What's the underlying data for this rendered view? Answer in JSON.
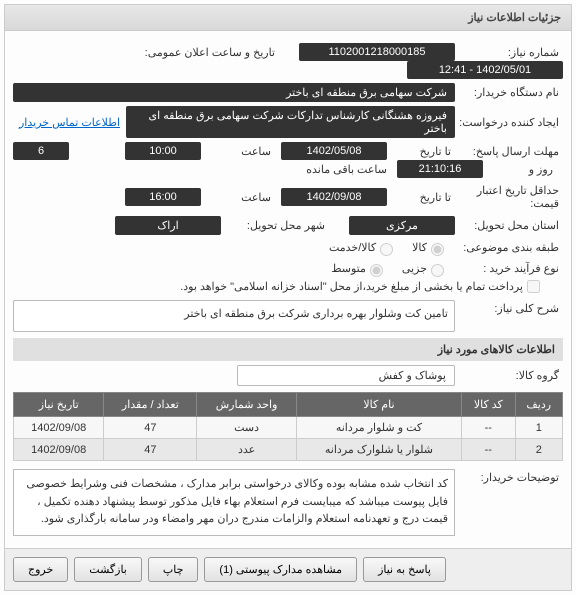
{
  "panel_title": "جزئیات اطلاعات نیاز",
  "fields": {
    "need_no_lbl": "شماره نیاز:",
    "need_no": "1102001218000185",
    "pub_date_lbl": "تاریخ و ساعت اعلان عمومی:",
    "pub_date": "1402/05/01 - 12:41",
    "buyer_lbl": "نام دستگاه خریدار:",
    "buyer": "شرکت سهامی برق منطقه ای باختر",
    "creator_lbl": "ایجاد کننده درخواست:",
    "creator": "فیروزه هشنگانی کارشناس تدارکات شرکت سهامی برق منطقه ای باختر",
    "contact_link": "اطلاعات تماس خریدار",
    "reply_deadline_lbl": "مهلت ارسال پاسخ:",
    "to_date_lbl": "تا تاریخ",
    "reply_date": "1402/05/08",
    "hour_lbl": "ساعت",
    "reply_hour": "10:00",
    "day_lbl": "روز و",
    "day_val": "6",
    "remain_lbl": "ساعت باقی مانده",
    "remain_val": "21:10:16",
    "price_valid_lbl": "حداقل تاریخ اعتبار\nقیمت:",
    "price_valid_date": "1402/09/08",
    "price_valid_hour": "16:00",
    "province_lbl": "استان محل تحویل:",
    "province": "مرکزی",
    "city_lbl": "شهر محل تحویل:",
    "city": "اراک",
    "cat_lbl": "طبقه بندی موضوعی:",
    "cat_goods": "کالا",
    "cat_service": "کالا/خدمت",
    "buy_type_lbl": "نوع فرآیند خرید :",
    "buy_partial": "جزیی",
    "buy_medium": "متوسط",
    "buy_note": "پرداخت تمام یا بخشی از مبلغ خرید،از محل \"اسناد خزانه اسلامی\" خواهد بود.",
    "desc_lbl": "شرح کلی نیاز:",
    "desc": "تامین کت وشلوار بهره برداری شرکت برق منطقه ای باختر",
    "items_title": "اطلاعات کالاهای مورد نیاز",
    "group_lbl": "گروه کالا:",
    "group": "پوشاک و کفش",
    "buyer_notes_lbl": "توضیحات خریدار:",
    "buyer_notes": "کد انتخاب شده مشابه بوده وکالای درخواستی برابر مدارک ، مشخصات فنی وشرایط خصوصی فایل پیوست میباشد که میبایست فرم استعلام بهاء فایل مذکور توسط پیشنهاد دهنده تکمیل ، قیمت درج و تعهدنامه استعلام والزامات  مندرج دران مهر وامضاء ودر سامانه بارگذاری شود."
  },
  "table": {
    "headers": [
      "ردیف",
      "کد کالا",
      "نام کالا",
      "واحد شمارش",
      "تعداد / مقدار",
      "تاریخ نیاز"
    ],
    "rows": [
      [
        "1",
        "--",
        "کت و شلوار مردانه",
        "دست",
        "47",
        "1402/09/08"
      ],
      [
        "2",
        "--",
        "شلوار یا شلوارک مردانه",
        "عدد",
        "47",
        "1402/09/08"
      ]
    ]
  },
  "buttons": {
    "back": "پاسخ به نیاز",
    "attach": "مشاهده مدارک پیوستی (1)",
    "print": "چاپ",
    "ret": "بازگشت",
    "exit": "خروج"
  }
}
